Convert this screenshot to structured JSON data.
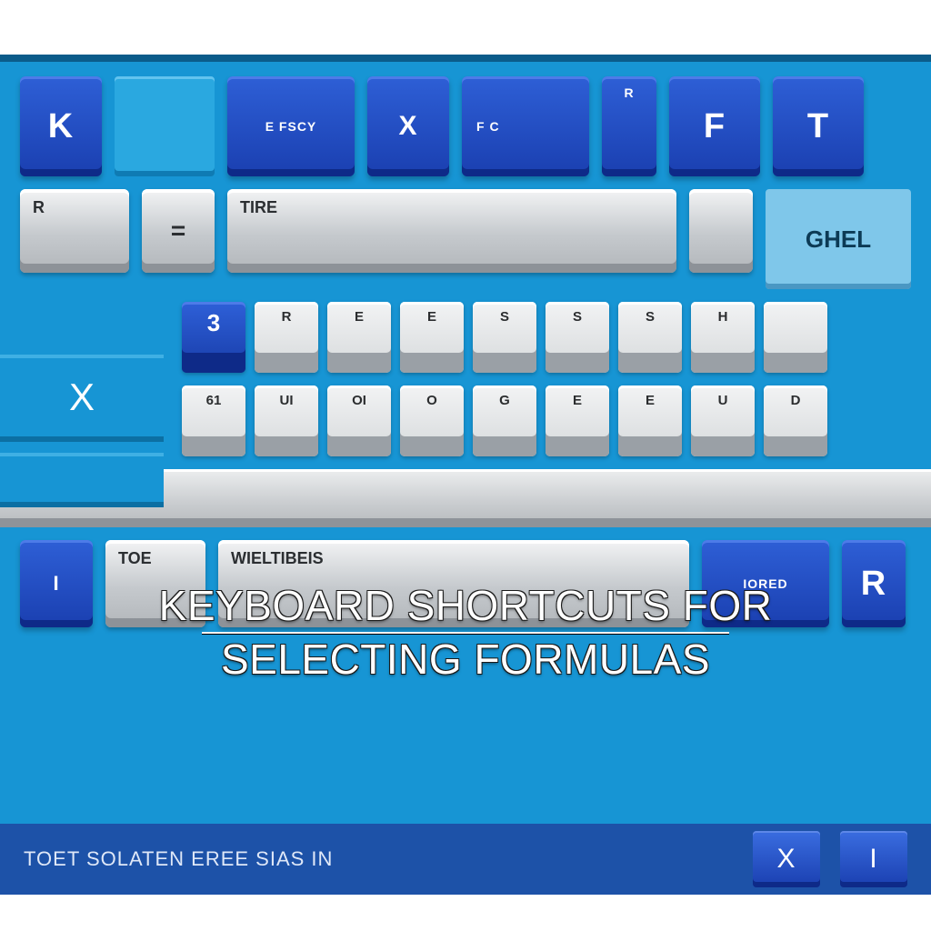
{
  "title_line1": "Keyboard Shortcuts For",
  "title_line2": "Selecting Formulas",
  "top_keys": {
    "k0": "K",
    "k1": "E FSCY",
    "k2": "X",
    "k3": "F C",
    "k4": "R",
    "k5": "F",
    "k6": "T"
  },
  "row2": {
    "a": "R",
    "b": "=",
    "c": "TIRE",
    "d": "GHEL"
  },
  "row3": {
    "g0": "3",
    "g1": "R",
    "g2": "E",
    "g3": "E",
    "g4": "S",
    "g5": "S",
    "g6": "S",
    "g7": "H"
  },
  "row4": {
    "g0": "61",
    "g1": "UI",
    "g2": "OI",
    "g3": "O",
    "g4": "G",
    "g5": "E",
    "g6": "E",
    "g7": "U",
    "g8": "D"
  },
  "left_x": "X",
  "space_row": {
    "a": "I",
    "b": "TOE",
    "c": "WIELTIBEIS",
    "d": "IORED",
    "e": "R"
  },
  "footer": {
    "text": "TOET  SOLATEN  EREE  SIAS  IN",
    "nav": "X",
    "nav2": "I"
  }
}
